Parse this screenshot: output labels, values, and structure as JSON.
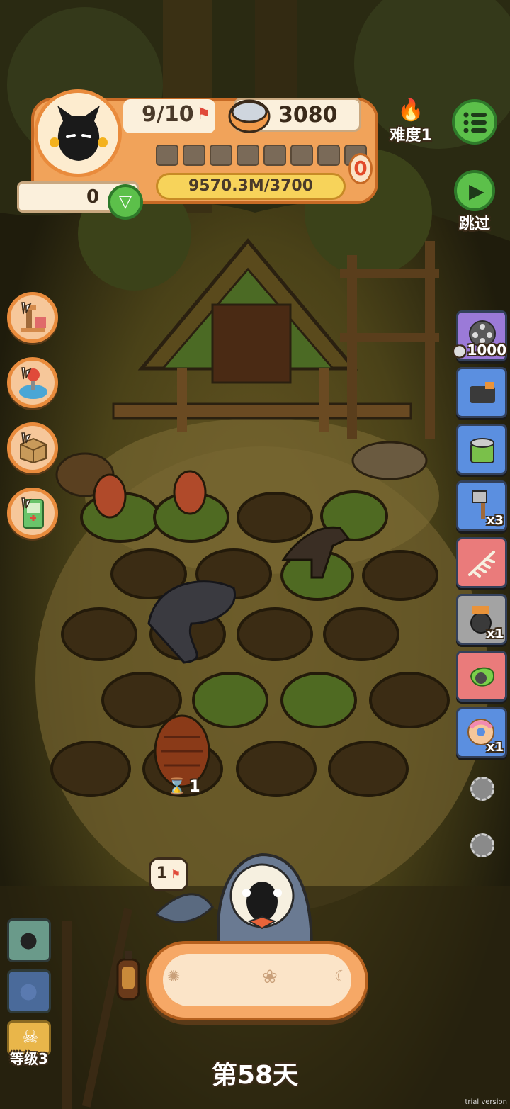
{
  "player": {
    "population": "9/10",
    "cans": "3080",
    "progress_text": "9570.3M/3700",
    "progress_badge": "0",
    "gems": "0",
    "level_slots_filled": 0,
    "level_slots_total": 8
  },
  "difficulty": {
    "label": "难度1"
  },
  "menu": {
    "icon": "menu-list-icon"
  },
  "skip": {
    "label": "跳过"
  },
  "side_buttons": [
    {
      "icon": "cat-tree-icon"
    },
    {
      "icon": "joystick-icon"
    },
    {
      "icon": "cardboard-box-icon"
    },
    {
      "icon": "handheld-console-icon"
    }
  ],
  "right_cards": [
    {
      "icon": "film-reel-icon",
      "count": "1000",
      "color": "#9b7ad8"
    },
    {
      "icon": "camera-icon",
      "count": "",
      "color": "#5b8fe0"
    },
    {
      "icon": "cat-food-can-icon",
      "count": "",
      "color": "#5b8fe0"
    },
    {
      "icon": "axe-icon",
      "count": "x3",
      "color": "#5b8fe0"
    },
    {
      "icon": "fossil-icon",
      "count": "",
      "color": "#ea7b7b"
    },
    {
      "icon": "robot-wheel-icon",
      "count": "x1",
      "color": "#a3a3a3"
    },
    {
      "icon": "slime-ore-icon",
      "count": "",
      "color": "#ea7b7b"
    },
    {
      "icon": "donut-icon",
      "count": "x1",
      "color": "#5b8fe0"
    }
  ],
  "egg_timer": "1",
  "shark_bubble": "1",
  "left_panel": {
    "level_label": "等级3"
  },
  "day_label": "第58天",
  "watermark": "trial version",
  "colors": {
    "accent_orange": "#e98b3c",
    "progress_yellow": "#f7d35a",
    "button_green": "#5cc04a"
  }
}
